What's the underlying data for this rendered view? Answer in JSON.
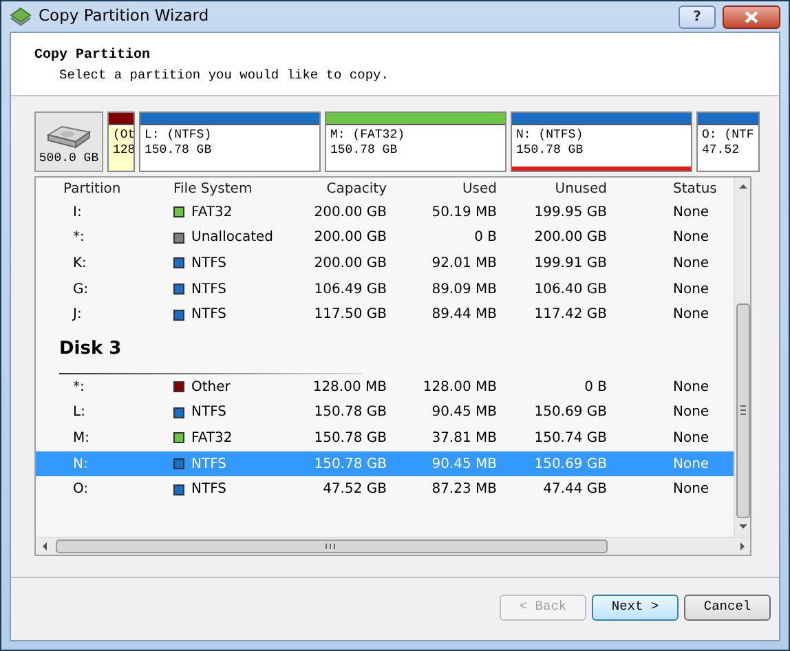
{
  "window": {
    "title": "Copy Partition Wizard",
    "help": "?"
  },
  "header": {
    "title": "Copy Partition",
    "subtitle": "Select a partition you would like to copy."
  },
  "disk_map": {
    "disk_size": "500.0 GB",
    "segments": [
      {
        "line1": "(Ot",
        "line2": "128",
        "color": "#800000",
        "level": 1,
        "selected": false
      },
      {
        "line1": "L: (NTFS)",
        "line2": "150.78 GB",
        "color": "#1a6fc4",
        "level": 0,
        "selected": false
      },
      {
        "line1": "M: (FAT32)",
        "line2": "150.78 GB",
        "color": "#6cc644",
        "level": 0,
        "selected": false
      },
      {
        "line1": "N: (NTFS)",
        "line2": "150.78 GB",
        "color": "#1a6fc4",
        "level": 0,
        "selected": true
      },
      {
        "line1": "O: (NTF",
        "line2": "47.52",
        "color": "#1a6fc4",
        "level": 0,
        "selected": false
      }
    ]
  },
  "table": {
    "columns": [
      "Partition",
      "File System",
      "Capacity",
      "Used",
      "Unused",
      "Status"
    ],
    "rows": [
      {
        "kind": "partition",
        "partition": "I:",
        "color": "#6cc644",
        "file_system": "FAT32",
        "capacity": "200.00 GB",
        "used": "50.19 MB",
        "unused": "199.95 GB",
        "status": "None",
        "selected": false
      },
      {
        "kind": "partition",
        "partition": "*:",
        "color": "#7f7f7f",
        "file_system": "Unallocated",
        "capacity": "200.00 GB",
        "used": "0 B",
        "unused": "200.00 GB",
        "status": "None",
        "selected": false
      },
      {
        "kind": "partition",
        "partition": "K:",
        "color": "#1a6fc4",
        "file_system": "NTFS",
        "capacity": "200.00 GB",
        "used": "92.01 MB",
        "unused": "199.91 GB",
        "status": "None",
        "selected": false
      },
      {
        "kind": "partition",
        "partition": "G:",
        "color": "#1a6fc4",
        "file_system": "NTFS",
        "capacity": "106.49 GB",
        "used": "89.09 MB",
        "unused": "106.40 GB",
        "status": "None",
        "selected": false
      },
      {
        "kind": "partition",
        "partition": "J:",
        "color": "#1a6fc4",
        "file_system": "NTFS",
        "capacity": "117.50 GB",
        "used": "89.44 MB",
        "unused": "117.42 GB",
        "status": "None",
        "selected": false
      },
      {
        "kind": "disk",
        "label": "Disk 3"
      },
      {
        "kind": "partition",
        "partition": "*:",
        "color": "#800000",
        "file_system": "Other",
        "capacity": "128.00 MB",
        "used": "128.00 MB",
        "unused": "0 B",
        "status": "None",
        "selected": false
      },
      {
        "kind": "partition",
        "partition": "L:",
        "color": "#1a6fc4",
        "file_system": "NTFS",
        "capacity": "150.78 GB",
        "used": "90.45 MB",
        "unused": "150.69 GB",
        "status": "None",
        "selected": false
      },
      {
        "kind": "partition",
        "partition": "M:",
        "color": "#6cc644",
        "file_system": "FAT32",
        "capacity": "150.78 GB",
        "used": "37.81 MB",
        "unused": "150.74 GB",
        "status": "None",
        "selected": false
      },
      {
        "kind": "partition",
        "partition": "N:",
        "color": "#1a6fc4",
        "file_system": "NTFS",
        "capacity": "150.78 GB",
        "used": "90.45 MB",
        "unused": "150.69 GB",
        "status": "None",
        "selected": true
      },
      {
        "kind": "partition",
        "partition": "O:",
        "color": "#1a6fc4",
        "file_system": "NTFS",
        "capacity": "47.52 GB",
        "used": "87.23 MB",
        "unused": "47.44 GB",
        "status": "None",
        "selected": false
      }
    ]
  },
  "buttons": [
    {
      "label": "< Back",
      "disabled": true,
      "default": false
    },
    {
      "label": "Next >",
      "disabled": false,
      "default": true
    },
    {
      "label": "Cancel",
      "disabled": false,
      "default": false
    }
  ]
}
